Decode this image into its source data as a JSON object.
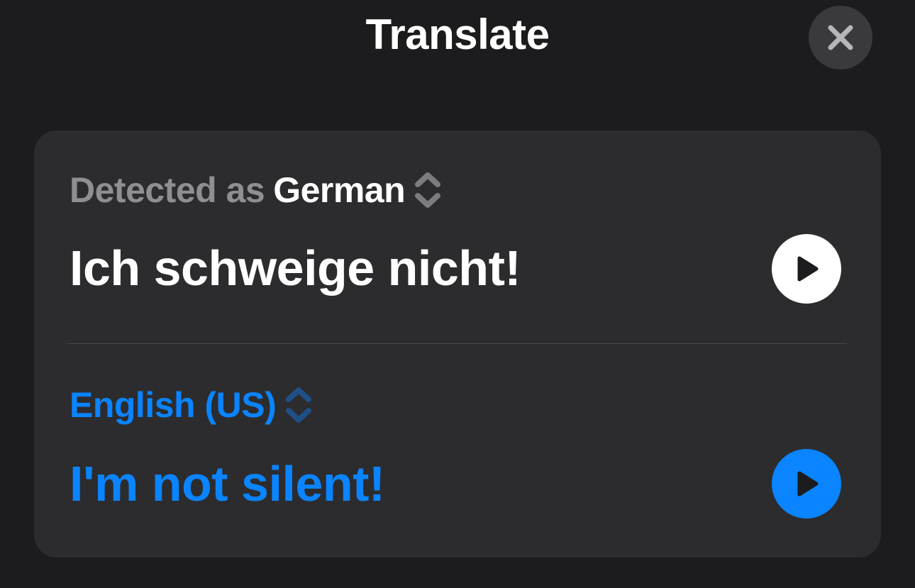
{
  "header": {
    "title": "Translate",
    "close_icon": "close-icon"
  },
  "source": {
    "detected_label": "Detected as",
    "language": "German",
    "text": "Ich schweige nicht!",
    "play_icon": "play-icon",
    "chevron_icon": "chevron-up-down-icon"
  },
  "target": {
    "language": "English (US)",
    "text": "I'm not silent!",
    "play_icon": "play-icon",
    "chevron_icon": "chevron-up-down-icon"
  },
  "colors": {
    "background": "#1c1c1e",
    "card": "#2c2c2e",
    "accent": "#0a84ff",
    "secondary_text": "#8e8e93",
    "primary_text": "#ffffff"
  }
}
